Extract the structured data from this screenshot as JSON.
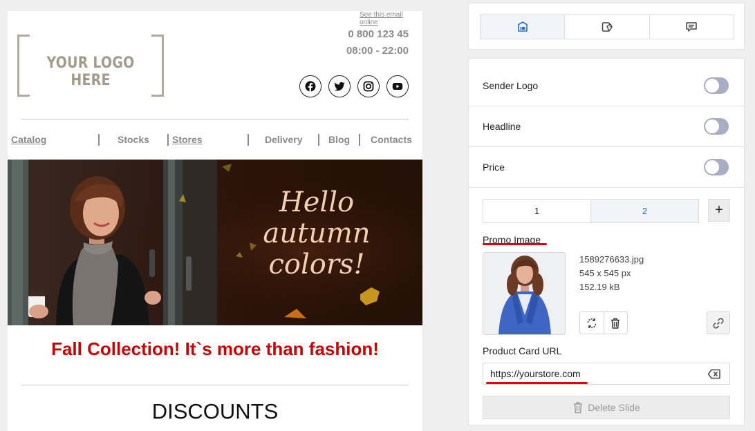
{
  "email": {
    "see_online": "See this email online",
    "logo_text": "YOUR LOGO HERE",
    "phone": "0 800 123 45",
    "hours": "08:00 - 22:00",
    "social_icons": [
      "facebook-icon",
      "twitter-icon",
      "instagram-icon",
      "youtube-icon"
    ],
    "nav": [
      "Catalog",
      "Stocks",
      "Stores",
      "Delivery",
      "Blog",
      "Contacts"
    ],
    "banner": {
      "line1": "Hello",
      "line2": "autumn",
      "line3": "colors!"
    },
    "headline": "Fall Collection! It`s more than fashion!",
    "headline_color": "#c90000",
    "section_title": "DISCOUNTS"
  },
  "panel": {
    "tabs": [
      {
        "icon": "card-layout-icon",
        "active": true
      },
      {
        "icon": "product-tag-icon",
        "active": false
      },
      {
        "icon": "message-icon",
        "active": false
      }
    ],
    "toggles": [
      {
        "label": "Sender Logo",
        "on": false
      },
      {
        "label": "Headline",
        "on": false
      },
      {
        "label": "Price",
        "on": false
      }
    ],
    "slides": [
      "1",
      "2"
    ],
    "add_slide_label": "+",
    "promo_label": "Promo Image",
    "file": {
      "name": "1589276633.jpg",
      "dimensions": "545 x 545 px",
      "size": "152.19 kB"
    },
    "url_label": "Product Card URL",
    "url_value": "https://yourstore.com",
    "delete_label": "Delete Slide",
    "accent_color": "#2b6bc6",
    "annotation_color": "#e00000"
  }
}
